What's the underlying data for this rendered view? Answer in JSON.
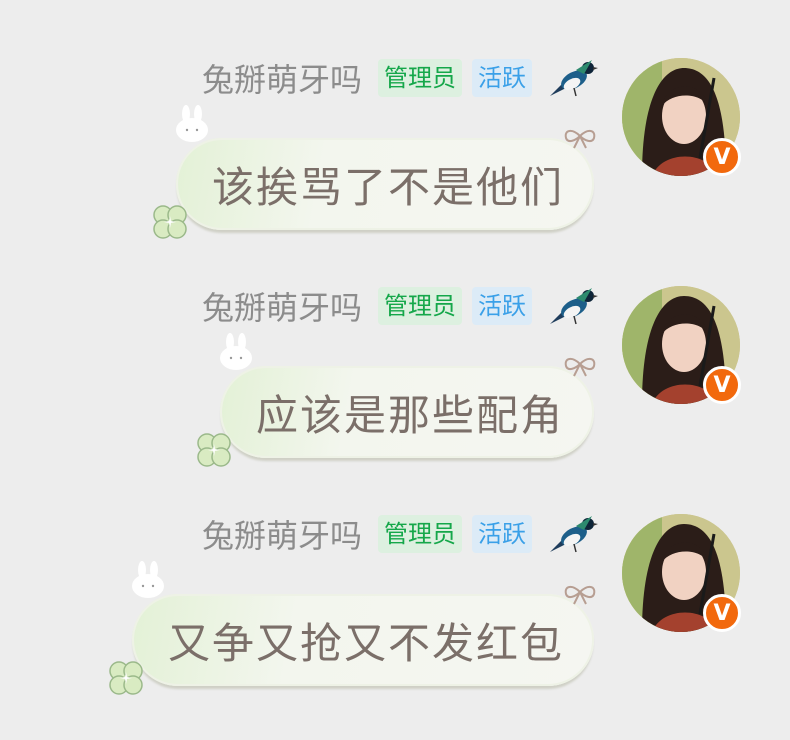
{
  "messages": [
    {
      "nickname": "兔掰萌牙吗",
      "tags": {
        "admin": "管理员",
        "active": "活跃"
      },
      "text": "该挨骂了不是他们",
      "badge": "V"
    },
    {
      "nickname": "兔掰萌牙吗",
      "tags": {
        "admin": "管理员",
        "active": "活跃"
      },
      "text": "应该是那些配角",
      "badge": "V"
    },
    {
      "nickname": "兔掰萌牙吗",
      "tags": {
        "admin": "管理员",
        "active": "活跃"
      },
      "text": "又争又抢又不发红包",
      "badge": "V"
    }
  ],
  "colors": {
    "admin_tag": "#15a74a",
    "active_tag": "#3aa0e8",
    "badge": "#f2690d",
    "background": "#ededed"
  }
}
